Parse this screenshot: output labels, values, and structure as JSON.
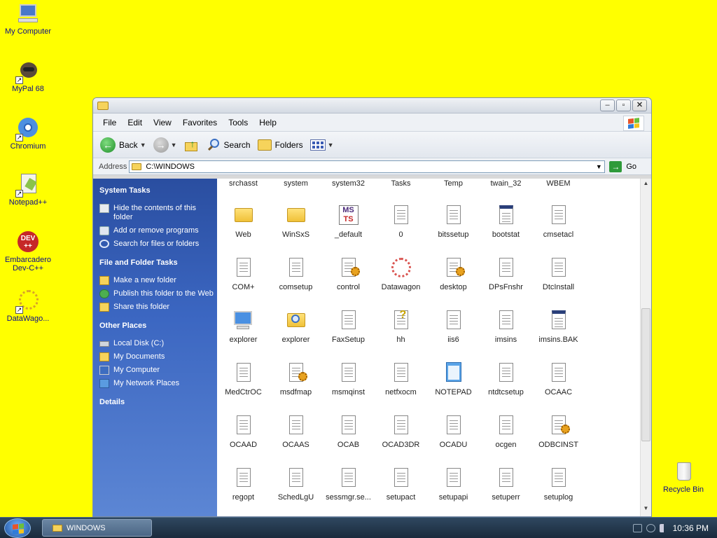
{
  "desktop": {
    "icons": [
      {
        "label": "My Computer"
      },
      {
        "label": "MyPal 68"
      },
      {
        "label": "Chromium"
      },
      {
        "label": "Notepad++"
      },
      {
        "label": "Embarcadero Dev-C++"
      },
      {
        "label": "DataWago..."
      },
      {
        "label": "Recycle Bin"
      }
    ]
  },
  "window": {
    "menu": [
      "File",
      "Edit",
      "View",
      "Favorites",
      "Tools",
      "Help"
    ],
    "toolbar": {
      "back": "Back",
      "search": "Search",
      "folders": "Folders"
    },
    "address": {
      "label": "Address",
      "value": "C:\\WINDOWS",
      "go": "Go"
    },
    "taskpane": {
      "system_tasks": {
        "title": "System Tasks",
        "links": [
          "Hide the contents of this folder",
          "Add or remove programs",
          "Search for files or folders"
        ]
      },
      "file_folder_tasks": {
        "title": "File and Folder Tasks",
        "links": [
          "Make a new folder",
          "Publish this folder to the Web",
          "Share this folder"
        ]
      },
      "other_places": {
        "title": "Other Places",
        "links": [
          "Local Disk (C:)",
          "My Documents",
          "My Computer",
          "My Network Places"
        ]
      },
      "details": {
        "title": "Details"
      }
    },
    "top_row": [
      "srchasst",
      "system",
      "system32",
      "Tasks",
      "Temp",
      "twain_32",
      "WBEM"
    ],
    "files": [
      [
        "Web",
        "WinSxS",
        "_default",
        "0",
        "bitssetup",
        "bootstat",
        "cmsetacl"
      ],
      [
        "COM+",
        "comsetup",
        "control",
        "Datawagon",
        "desktop",
        "DPsFnshr",
        "DtcInstall"
      ],
      [
        "explorer",
        "explorer",
        "FaxSetup",
        "hh",
        "iis6",
        "imsins",
        "imsins.BAK"
      ],
      [
        "MedCtrOC",
        "msdfmap",
        "msmqinst",
        "netfxocm",
        "NOTEPAD",
        "ntdtcsetup",
        "OCAAC"
      ],
      [
        "OCAAD",
        "OCAAS",
        "OCAB",
        "OCAD3DR",
        "OCADU",
        "ocgen",
        "ODBCINST"
      ],
      [
        "regopt",
        "SchedLgU",
        "sessmgr.se...",
        "setupact",
        "setupapi",
        "setuperr",
        "setuplog"
      ]
    ]
  },
  "taskbar": {
    "task": "WINDOWS",
    "time": "10:36 PM"
  }
}
